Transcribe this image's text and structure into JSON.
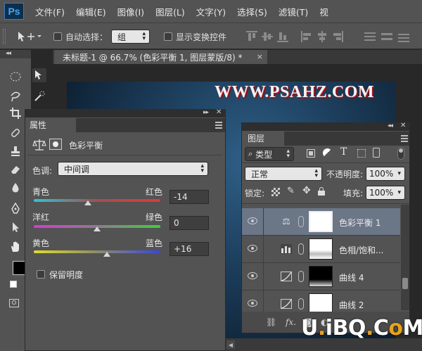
{
  "app": {
    "logo": "Ps"
  },
  "menu": {
    "items": [
      "文件(F)",
      "编辑(E)",
      "图像(I)",
      "图层(L)",
      "文字(Y)",
      "选择(S)",
      "滤镜(T)",
      "视"
    ]
  },
  "options": {
    "auto_select_label": "自动选择：",
    "auto_select_value": "组",
    "show_transform_label": "显示变换控件"
  },
  "document": {
    "tab_title": "未标题-1 @ 66.7% (色彩平衡 1, 图层蒙版/8) *",
    "close_glyph": "×"
  },
  "image_watermark": "WWW.PSAHZ.COM",
  "properties": {
    "tab": "属性",
    "adjustment_name": "色彩平衡",
    "tone_label": "色调:",
    "tone_value": "中间调",
    "sliders": [
      {
        "left": "青色",
        "right": "红色",
        "value": "-14",
        "level": -14
      },
      {
        "left": "洋红",
        "right": "绿色",
        "value": "0",
        "level": 0
      },
      {
        "left": "黄色",
        "right": "蓝色",
        "value": "+16",
        "level": 16
      }
    ],
    "preserve_luminosity": "保留明度"
  },
  "layers": {
    "tab": "图层",
    "filter_kind": "类型",
    "blend_mode": "正常",
    "opacity_label": "不透明度:",
    "opacity_value": "100%",
    "lock_label": "锁定:",
    "fill_label": "填充:",
    "fill_value": "100%",
    "rows": [
      {
        "name": "色彩平衡 1",
        "icon": "balance-icon",
        "selected": true,
        "mask": "white"
      },
      {
        "name": "色相/饱和...",
        "icon": "hue-saturation-icon",
        "selected": false,
        "mask": "white-gray"
      },
      {
        "name": "曲线 4",
        "icon": "curves-icon",
        "selected": false,
        "mask": "black-white"
      },
      {
        "name": "曲线 2",
        "icon": "curves-icon",
        "selected": false,
        "mask": "white"
      }
    ]
  },
  "site_watermark": {
    "a": "U",
    "b": "iBQ",
    "c": "C",
    "d": "M"
  },
  "colors": {
    "ui_bg": "#535353",
    "selected_layer": "#6b7687",
    "cyan_red": [
      "#2ec4d6",
      "#e0383a"
    ],
    "magenta_green": [
      "#d63ad0",
      "#3ad23a"
    ],
    "yellow_blue": [
      "#dedc2a",
      "#3a46e0"
    ]
  }
}
